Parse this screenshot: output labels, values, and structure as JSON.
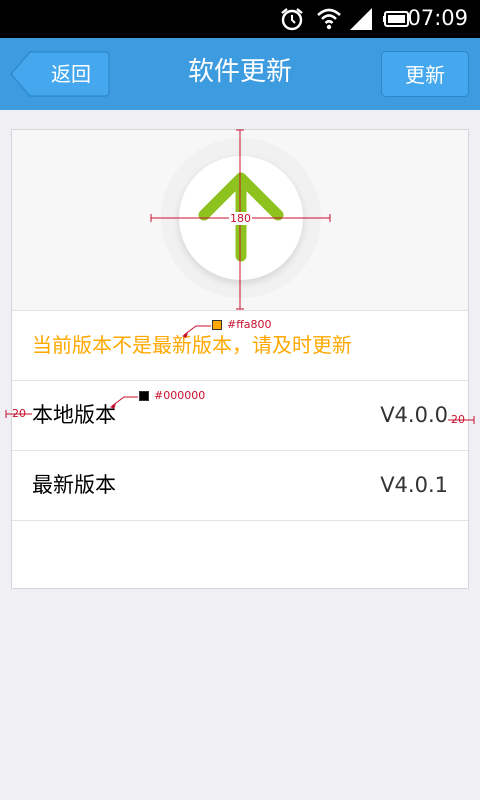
{
  "status_bar": {
    "time": "07:09",
    "icons": [
      "alarm-icon",
      "wifi-icon",
      "signal-icon",
      "battery-icon"
    ]
  },
  "nav": {
    "back_label": "返回",
    "title": "软件更新",
    "update_label": "更新"
  },
  "notice": {
    "text": "当前版本不是最新版本，请及时更新"
  },
  "versions": [
    {
      "label": "本地版本",
      "value": "V4.0.0"
    },
    {
      "label": "最新版本",
      "value": "V4.0.1"
    }
  ],
  "annotations": {
    "hero_size": "180",
    "notice_color": "#ffa800",
    "text_color": "#000000",
    "left_padding": "20",
    "right_padding": "20"
  },
  "colors": {
    "nav_background": "#3d9be0",
    "accent_green": "#8dc21f",
    "notice": "#ffa800",
    "annotation": "#c8102e"
  }
}
